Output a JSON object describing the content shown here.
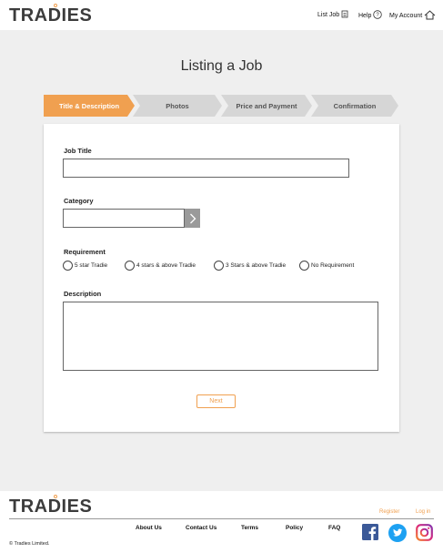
{
  "brand": {
    "logo": "TRADIES",
    "accent": "#f0a050"
  },
  "header": {
    "list_job": "List Job",
    "help": "Help",
    "account": "My Account"
  },
  "page": {
    "title": "Listing a Job"
  },
  "steps": [
    {
      "label": "Title & Description",
      "active": true
    },
    {
      "label": "Photos",
      "active": false
    },
    {
      "label": "Price and Payment",
      "active": false
    },
    {
      "label": "Confirmation",
      "active": false
    }
  ],
  "form": {
    "job_title_label": "Job Title",
    "job_title_value": "",
    "category_label": "Category",
    "category_value": "",
    "requirement_label": "Requirement",
    "requirement_options": [
      "5 star Tradie",
      "4 stars &  above Tradie",
      "3 Stars & above Tradie",
      "No Requirement"
    ],
    "description_label": "Description",
    "description_value": "",
    "next_label": "Next"
  },
  "footer": {
    "logo": "TRADIES",
    "register": "Register",
    "login": "Log in",
    "links": [
      "About Us",
      "Contact Us",
      "Terms",
      "Policy",
      "FAQ"
    ],
    "copyright": "© Tradies Limited.",
    "social": [
      "facebook-icon",
      "twitter-icon",
      "instagram-icon"
    ]
  }
}
